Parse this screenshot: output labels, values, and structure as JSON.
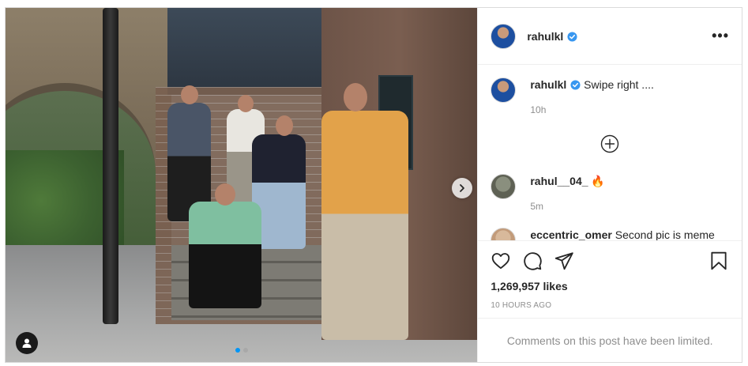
{
  "post": {
    "author": "rahulkl",
    "verified": true,
    "more_label": "•••"
  },
  "caption": {
    "username": "rahulkl",
    "text": "Swipe right ....",
    "time": "10h"
  },
  "comments": [
    {
      "username": "rahul__04_",
      "text": "🔥",
      "time": "5m"
    },
    {
      "username": "eccentric_omer",
      "text": "Second pic is meme"
    }
  ],
  "stats": {
    "likes": "1,269,957 likes",
    "posted": "10 HOURS AGO"
  },
  "comments_limited": "Comments on this post have been limited.",
  "carousel": {
    "count": 2,
    "active_index": 0
  },
  "icons": {
    "like": "heart-icon",
    "comment": "comment-bubble-icon",
    "share": "paper-plane-icon",
    "save": "bookmark-icon",
    "next": "chevron-right-icon",
    "tag": "user-tag-icon",
    "load_more": "plus-circle-icon"
  },
  "colors": {
    "verified": "#3897f0",
    "carousel_active": "#0095f6",
    "muted": "#8e8e8e"
  }
}
